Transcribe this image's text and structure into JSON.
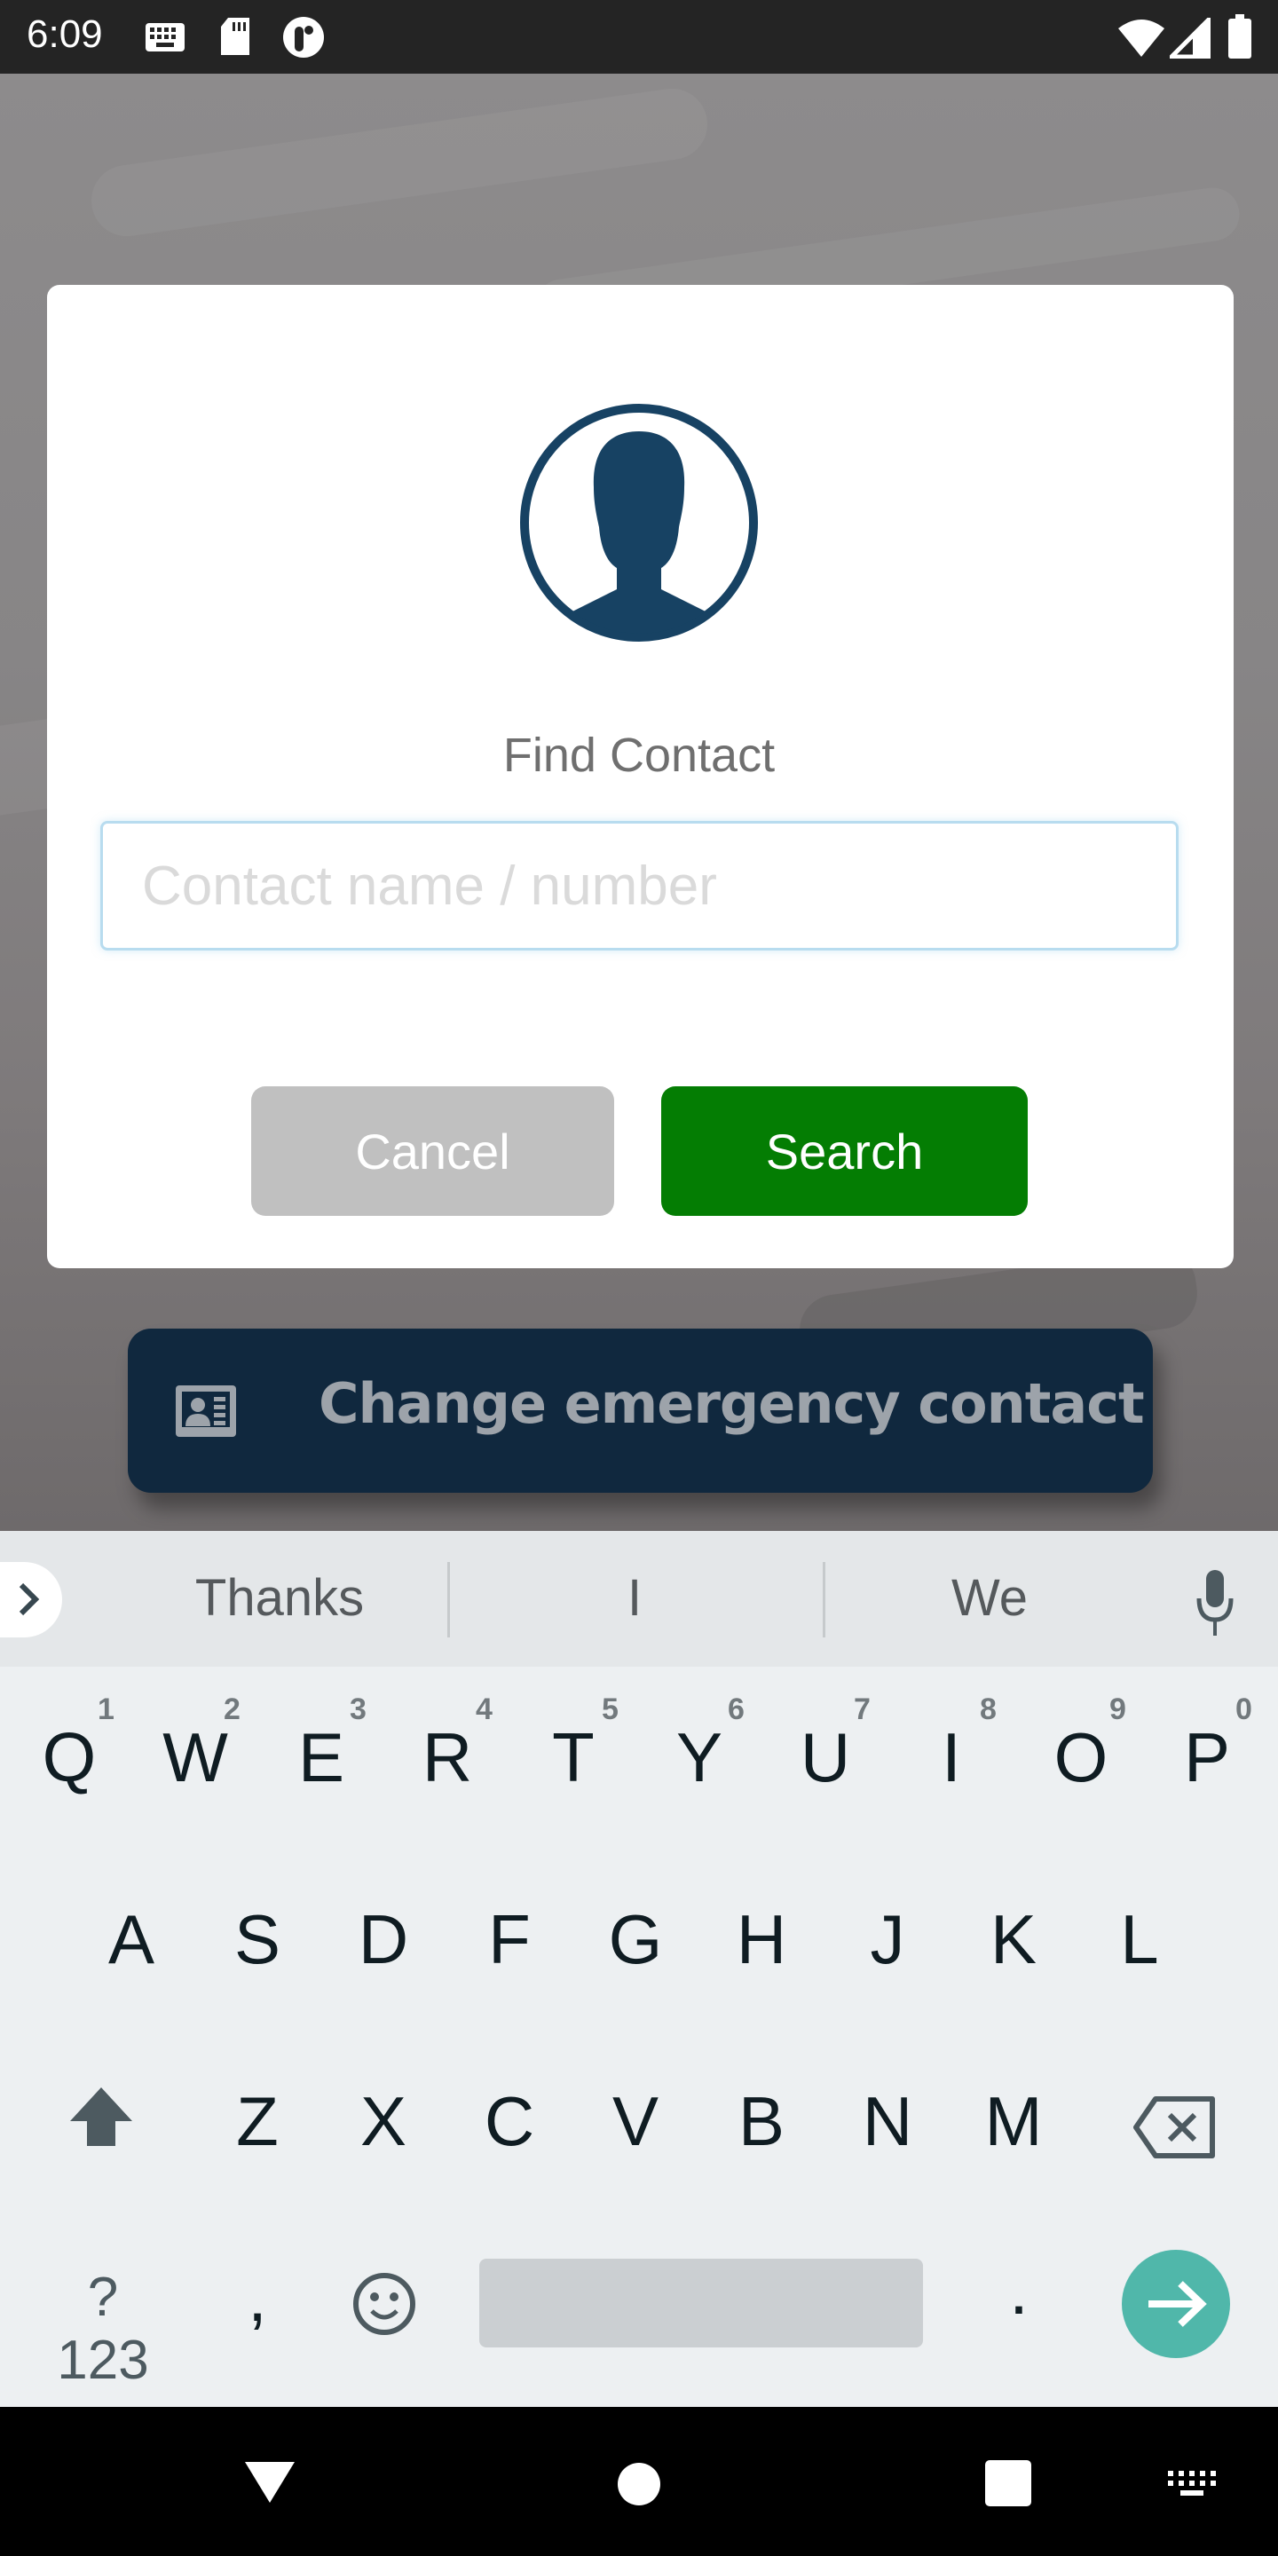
{
  "status_bar": {
    "time": "6:09",
    "left_icons": [
      "keyboard-icon",
      "sd-card-icon",
      "app-notification-icon"
    ],
    "right_icons": [
      "wifi-icon",
      "cell-signal-icon",
      "battery-icon"
    ]
  },
  "dialog": {
    "avatar_icon": "person-silhouette-icon",
    "title": "Find Contact",
    "input": {
      "value": "",
      "placeholder": "Contact name / number"
    },
    "cancel_label": "Cancel",
    "search_label": "Search",
    "colors": {
      "avatar": "#174263",
      "search": "#047d03",
      "cancel": "#c0c0c0",
      "input_border": "#b8dcef"
    }
  },
  "background_action": {
    "label": "Change emergency contact",
    "icon": "contact-card-icon",
    "color": "#10283e"
  },
  "keyboard": {
    "suggestions": [
      "Thanks",
      "I",
      "We"
    ],
    "row1": [
      "Q",
      "W",
      "E",
      "R",
      "T",
      "Y",
      "U",
      "I",
      "O",
      "P"
    ],
    "row1_hints": [
      "1",
      "2",
      "3",
      "4",
      "5",
      "6",
      "7",
      "8",
      "9",
      "0"
    ],
    "row2": [
      "A",
      "S",
      "D",
      "F",
      "G",
      "H",
      "J",
      "K",
      "L"
    ],
    "row3": [
      "Z",
      "X",
      "C",
      "V",
      "B",
      "N",
      "M"
    ],
    "symbols_label": "?123",
    "comma": ",",
    "period": ".",
    "enter_color": "#50b7aa"
  },
  "nav_bar": {
    "icons": [
      "back-icon",
      "home-icon",
      "recents-icon",
      "keyboard-switch-icon"
    ]
  }
}
